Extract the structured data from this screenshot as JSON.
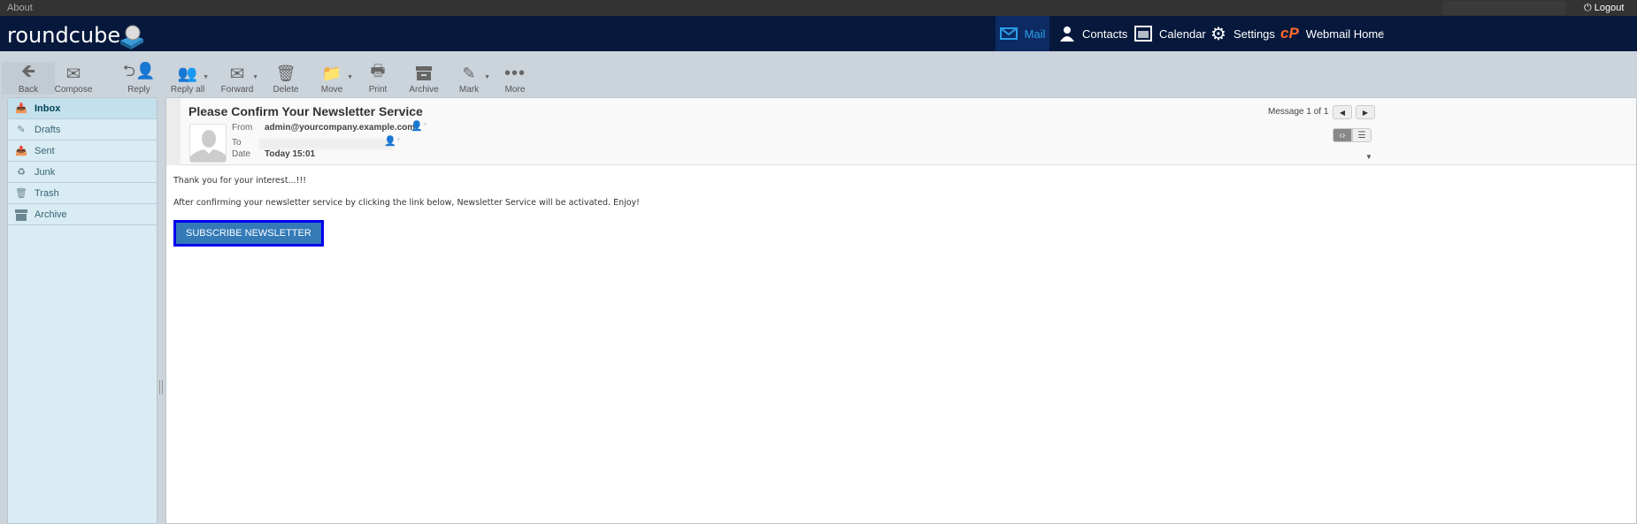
{
  "topbar": {
    "about": "About",
    "logout": "Logout"
  },
  "header": {
    "logo": "roundcube",
    "nav": [
      {
        "label": "Mail",
        "active": true
      },
      {
        "label": "Contacts"
      },
      {
        "label": "Calendar"
      },
      {
        "label": "Settings"
      },
      {
        "label": "Webmail Home"
      }
    ]
  },
  "toolbar": [
    "Back",
    "Compose",
    "Reply",
    "Reply all",
    "Forward",
    "Delete",
    "Move",
    "Print",
    "Archive",
    "Mark",
    "More"
  ],
  "folders": [
    "Inbox",
    "Drafts",
    "Sent",
    "Junk",
    "Trash",
    "Archive"
  ],
  "message": {
    "subject": "Please Confirm Your Newsletter Service",
    "from_label": "From",
    "from": "admin@yourcompany.example.com",
    "to_label": "To",
    "date_label": "Date",
    "date": "Today 15:01",
    "counter": "Message 1 of 1",
    "body": [
      "Thank you for your interest...!!!",
      "After confirming your newsletter service by clicking the link below, Newsletter Service will be activated. Enjoy!"
    ],
    "button": "SUBSCRIBE NEWSLETTER"
  },
  "colors": {
    "header": "#06193c",
    "accent": "#2a9ee8",
    "button": "#337ab7"
  }
}
